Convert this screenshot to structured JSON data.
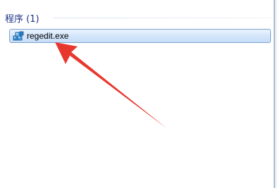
{
  "section": {
    "title": "程序 (1)"
  },
  "results": [
    {
      "label": "regedit.exe",
      "icon": "registry-editor-icon"
    }
  ],
  "annotation": {
    "arrow_color": "#e8382e"
  },
  "colors": {
    "section_title": "#1e3287",
    "row_border": "#7da2ce",
    "row_fill": "#d4e6fa"
  }
}
